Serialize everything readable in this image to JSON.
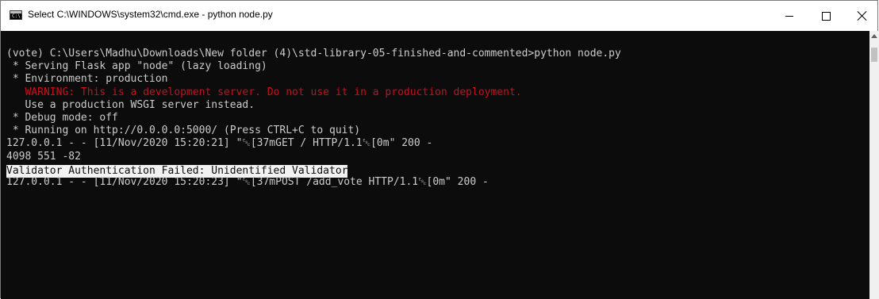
{
  "window": {
    "title": "Select C:\\WINDOWS\\system32\\cmd.exe - python  node.py",
    "icon": "cmd-icon",
    "controls": [
      "minimize",
      "maximize",
      "close"
    ]
  },
  "console": {
    "lines": [
      "(vote) C:\\Users\\Madhu\\Downloads\\New folder (4)\\std-library-05-finished-and-commented>python node.py",
      " * Serving Flask app \"node\" (lazy loading)",
      " * Environment: production",
      "   WARNING: This is a development server. Do not use it in a production deployment.",
      "   Use a production WSGI server instead.",
      " * Debug mode: off",
      " * Running on http://0.0.0.0:5000/ (Press CTRL+C to quit)",
      "127.0.0.1 - - [11/Nov/2020 15:20:21] \"␛[37mGET / HTTP/1.1␛[0m\" 200 -",
      "4098 551 -82",
      "Validator Authentication Failed: Unidentified Validator",
      "127.0.0.1 - - [11/Nov/2020 15:20:23] \"␛[37mPOST /add_vote HTTP/1.1␛[0m\" 200 -"
    ]
  },
  "colors": {
    "console_bg": "#0c0c0c",
    "console_text": "#cccccc",
    "warning_text": "#c50f1f",
    "selection_bg": "#f2f2f2"
  }
}
